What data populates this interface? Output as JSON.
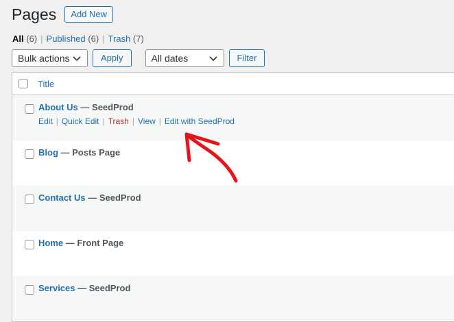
{
  "header": {
    "title": "Pages",
    "add_new": "Add New"
  },
  "views": {
    "all_label": "All",
    "all_count": "(6)",
    "published_label": "Published",
    "published_count": "(6)",
    "trash_label": "Trash",
    "trash_count": "(7)"
  },
  "filters": {
    "bulk_actions": "Bulk actions",
    "apply": "Apply",
    "dates": "All dates",
    "filter": "Filter"
  },
  "table": {
    "column_title": "Title",
    "rows": [
      {
        "name": "About Us",
        "state": "— SeedProd"
      },
      {
        "name": "Blog",
        "state": "— Posts Page"
      },
      {
        "name": "Contact Us",
        "state": "— SeedProd"
      },
      {
        "name": "Home",
        "state": "— Front Page"
      },
      {
        "name": "Services",
        "state": "— SeedProd"
      }
    ],
    "row_actions": {
      "edit": "Edit",
      "quick_edit": "Quick Edit",
      "trash": "Trash",
      "view": "View",
      "edit_seedprod": "Edit with SeedProd"
    }
  },
  "annotation": {
    "arrow_color": "#e8131b"
  }
}
